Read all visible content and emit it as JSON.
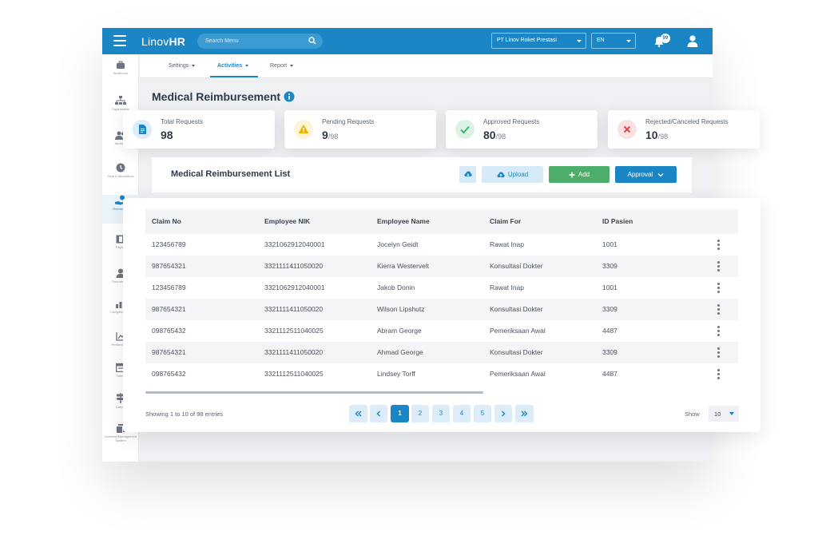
{
  "topbar": {
    "brand_prefix": "Linov",
    "brand_suffix": "HR",
    "search_placeholder": "Search Menu",
    "company": "PT Linov Roket Prestasi",
    "language": "EN",
    "notification_count": "99",
    "accent_color": "#1a86c6"
  },
  "sidebar": {
    "items": [
      {
        "label": "Workforce",
        "icon": "workforce-icon"
      },
      {
        "label": "Organization",
        "icon": "org-chart-icon"
      },
      {
        "label": "Workers",
        "icon": "users-icon"
      },
      {
        "label": "Time & Attendance",
        "icon": "clock-icon"
      },
      {
        "label": "Reimburse",
        "icon": "reimburse-icon"
      },
      {
        "label": "Payroll",
        "icon": "payroll-icon"
      },
      {
        "label": "Recruitment",
        "icon": "person-icon"
      },
      {
        "label": "Compensation",
        "icon": "bar-chart-icon"
      },
      {
        "label": "Performance",
        "icon": "line-chart-icon"
      },
      {
        "label": "Talent",
        "icon": "calendar-icon"
      },
      {
        "label": "Career",
        "icon": "signpost-icon"
      },
      {
        "label": "Learning Management System",
        "icon": "lms-icon"
      }
    ]
  },
  "subnav": {
    "settings": "Settings",
    "activities": "Activities",
    "report": "Report"
  },
  "page": {
    "title": "Medical Reimbursement"
  },
  "stats": [
    {
      "label": "Total Requests",
      "value": "98",
      "total": "",
      "color": "#1a86c6"
    },
    {
      "label": "Pending Requests",
      "value": "9",
      "total": "/98",
      "color": "#f0b400"
    },
    {
      "label": "Approved Requests",
      "value": "80",
      "total": "/98",
      "color": "#3bb86a"
    },
    {
      "label": "Rejected/Canceled Requests",
      "value": "10",
      "total": "/98",
      "color": "#e04848"
    }
  ],
  "list": {
    "title": "Medical Reimbursement List",
    "upload_label": "Upload",
    "add_label": "Add",
    "approval_label": "Approval"
  },
  "table": {
    "columns": [
      "Claim No",
      "Employee NIK",
      "Employee Name",
      "Claim For",
      "ID Pasien"
    ],
    "rows": [
      [
        "123456789",
        "3321062912040001",
        "Jocelyn Geidt",
        "Rawat Inap",
        "1001"
      ],
      [
        "987654321",
        "3321111411050020",
        "Kierra Westervelt",
        "Konsultasi Dokter",
        "3309"
      ],
      [
        "123456789",
        "3321062912040001",
        "Jakob Donin",
        "Rawat Inap",
        "1001"
      ],
      [
        "987654321",
        "3321111411050020",
        "Wilson Lipshutz",
        "Konsultasi Dokter",
        "3309"
      ],
      [
        "098765432",
        "3321112511040025",
        "Abram George",
        "Pemeriksaan Awal",
        "4487"
      ],
      [
        "987654321",
        "3321111411050020",
        "Ahmad George",
        "Konsultasi Dokter",
        "3309"
      ],
      [
        "098765432",
        "3321112511040025",
        "Lindsey Torff",
        "Pemeriksaan Awal",
        "4487"
      ]
    ]
  },
  "footer": {
    "showing": "Showing 1 to 10 of 98 entries",
    "pages": [
      "1",
      "2",
      "3",
      "4",
      "5"
    ],
    "current_page": "1",
    "show_label": "Show",
    "page_size": "10"
  }
}
